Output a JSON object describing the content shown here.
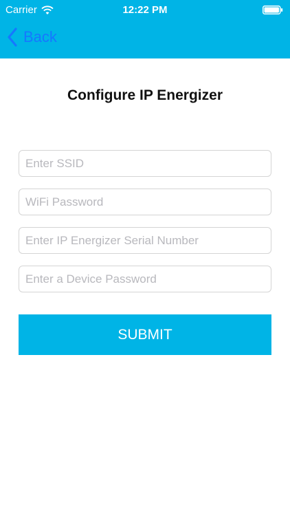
{
  "status_bar": {
    "carrier": "Carrier",
    "time": "12:22 PM",
    "wifi_icon": "wifi-icon",
    "battery_icon": "battery-icon"
  },
  "nav": {
    "back_label": "Back",
    "back_icon": "chevron-left-icon"
  },
  "page": {
    "title": "Configure IP Energizer"
  },
  "form": {
    "ssid": {
      "value": "",
      "placeholder": "Enter SSID"
    },
    "wifi_password": {
      "value": "",
      "placeholder": "WiFi Password"
    },
    "serial_number": {
      "value": "",
      "placeholder": "Enter IP Energizer Serial Number"
    },
    "device_password": {
      "value": "",
      "placeholder": "Enter a Device Password"
    },
    "submit_label": "SUBMIT"
  },
  "colors": {
    "accent": "#00b4e6",
    "link": "#1677ff",
    "placeholder": "#b8b8bd",
    "border": "#d4d4d4"
  }
}
